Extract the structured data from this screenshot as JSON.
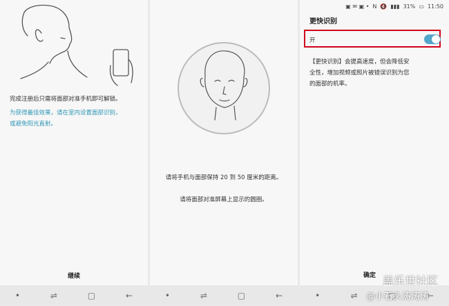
{
  "screen1": {
    "instruction": "完成注册后只需将面部对准手机即可解锁。",
    "tip_line1": "为获得最佳效果，请在室内设置面部识别，",
    "tip_line2": "或避免阳光直射。",
    "continue_label": "继续",
    "tip_color": "#2f97b5"
  },
  "screen2": {
    "distance_text": "请将手机与面部保持 20 到 50 厘米的距离。",
    "align_text": "请将面部对准屏幕上显示的圆圈。"
  },
  "screen3": {
    "status": {
      "battery": "31%",
      "time": "11:50"
    },
    "title": "更快识别",
    "toggle_label": "开",
    "toggle_on": true,
    "description_line1": "【更快识别】会提高速度，但会降低安",
    "description_line2": "全性，增加视频或照片被错误识别为您",
    "description_line3": "的面部的机率。",
    "confirm_label": "确定",
    "highlight_color": "#d0021b",
    "accent_color": "#52a6c9"
  },
  "watermark": {
    "line1": "盖乐世社区",
    "line2": "@小石头涛涛涛"
  }
}
